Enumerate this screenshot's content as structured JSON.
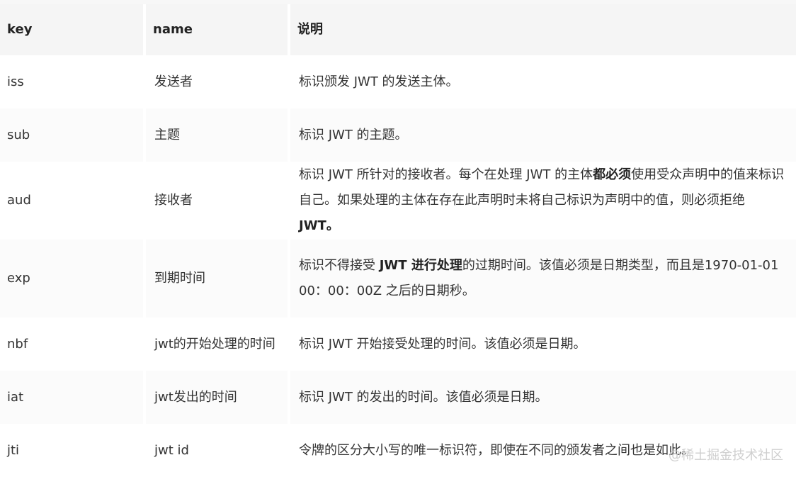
{
  "headers": {
    "key": "key",
    "name": "name",
    "desc": "说明"
  },
  "rows": [
    {
      "key": "iss",
      "name": "发送者",
      "desc": [
        "标识颁发 JWT 的发送主体。"
      ]
    },
    {
      "key": "sub",
      "name": "主题",
      "desc": [
        "标识 JWT 的主题。"
      ]
    },
    {
      "key": "aud",
      "name": "接收者",
      "desc": [
        "标识 JWT 所针对的接收者。每个在处理 JWT 的主体",
        "都必须",
        "使用受众声明中的值来标识自己。如果处理的主体在存在此声明时未将自己标识为声明中的值，则必须拒绝 ",
        "JWT。"
      ]
    },
    {
      "key": "exp",
      "name": "到期时间",
      "desc": [
        "标识不得接受 ",
        "JWT 进行处理",
        "的过期时间。该值必须是日期类型，而且是1970-01-01 00：00：00Z 之后的日期秒。"
      ]
    },
    {
      "key": "nbf",
      "name": "jwt的开始处理的时间",
      "desc": [
        "标识 JWT 开始接受处理的时间。该值必须是日期。"
      ]
    },
    {
      "key": "iat",
      "name": "jwt发出的时间",
      "desc": [
        "标识 JWT 的发出的时间。该值必须是日期。"
      ]
    },
    {
      "key": "jti",
      "name": "jwt id",
      "desc": [
        "令牌的区分大小写的唯一标识符，即使在不同的颁发者之间也是如此。"
      ]
    }
  ],
  "watermark": "@稀土掘金技术社区"
}
